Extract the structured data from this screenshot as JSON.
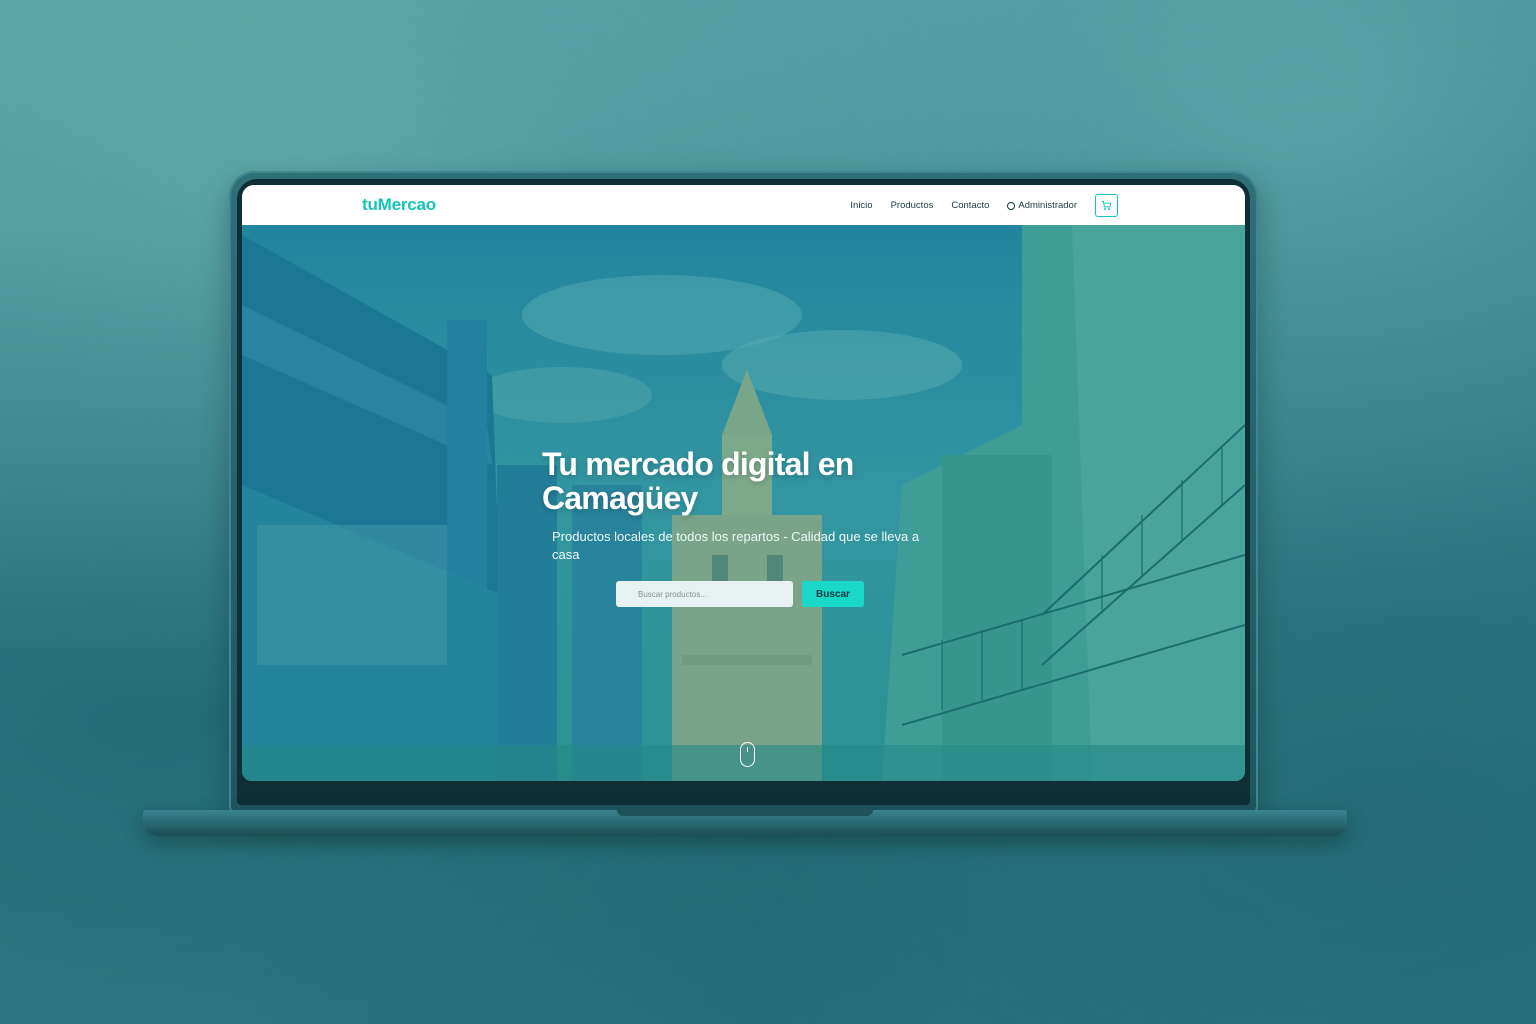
{
  "brand": "tuMercao",
  "nav": {
    "inicio": "Inicio",
    "productos": "Productos",
    "contacto": "Contacto",
    "administrador": "Administrador"
  },
  "hero": {
    "title": "Tu mercado digital en Camagüey",
    "subtitle": "Productos locales de todos los repartos - Calidad que se lleva a casa",
    "search_placeholder": "Buscar productos...",
    "search_button": "Buscar"
  },
  "icons": {
    "cart": "cart-icon",
    "admin": "circle-icon",
    "scroll": "scroll-mouse-icon"
  },
  "colors": {
    "brand": "#14c4b8",
    "button": "#19d8c8",
    "background": "#3a8a90"
  }
}
